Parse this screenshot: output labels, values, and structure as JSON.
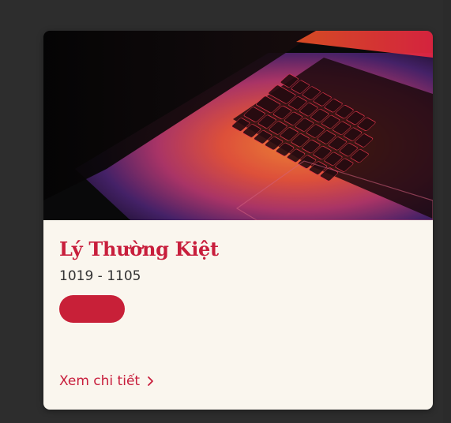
{
  "card": {
    "image_alt": "laptop-keyboard-photo",
    "name": "Lý Thường Kiệt",
    "years": "1019 - 1105",
    "tag_label": "",
    "link_label": "Xem chi tiết",
    "link_icon": "chevron-right-icon"
  },
  "colors": {
    "page_bg": "#2d2d2d",
    "card_bg": "#faf6ee",
    "accent": "#c81e3c",
    "text": "#333333"
  }
}
